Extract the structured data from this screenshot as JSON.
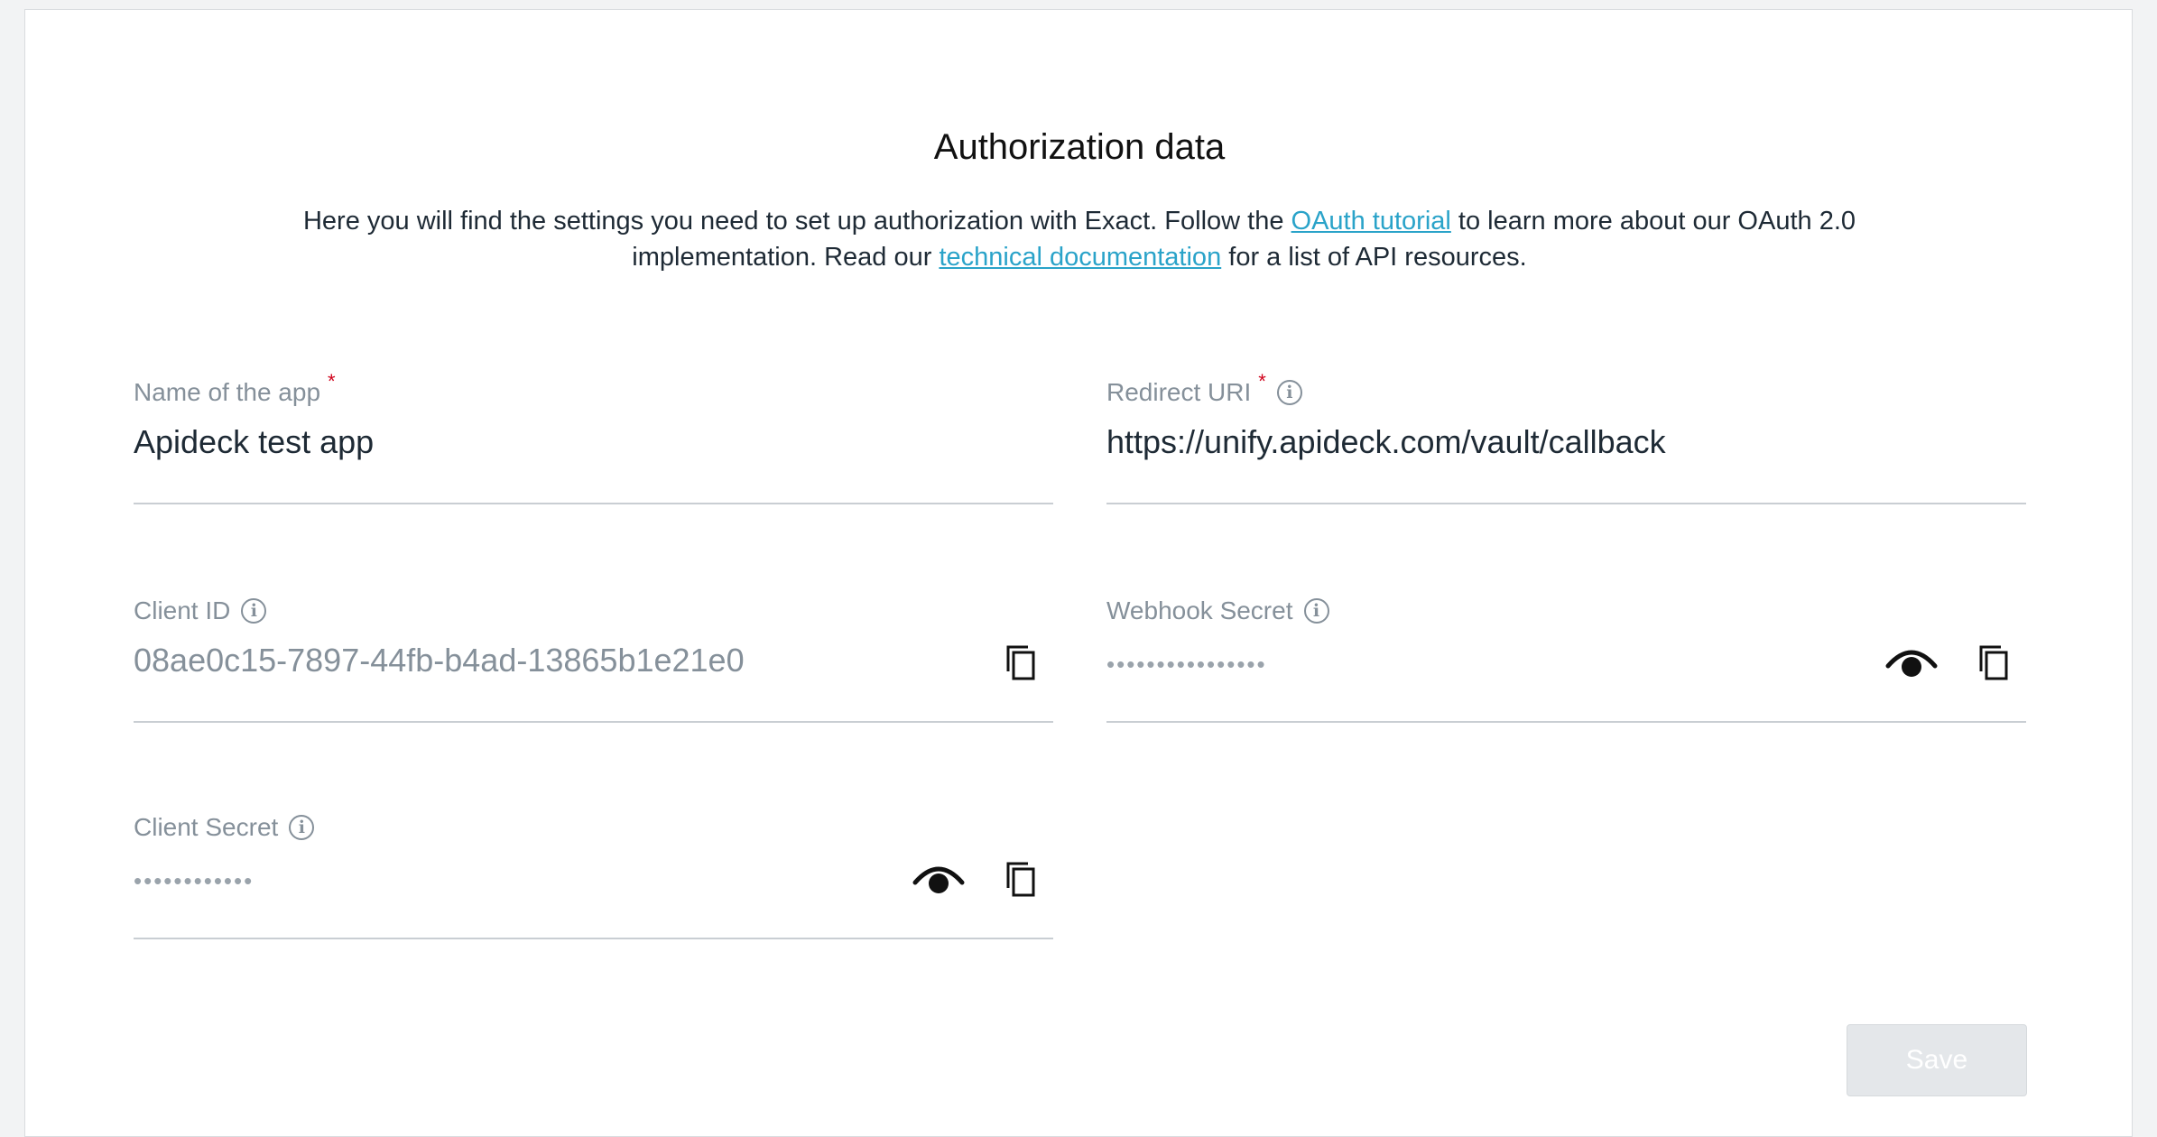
{
  "title": "Authorization data",
  "intro": {
    "before_link1": "Here you will find the settings you need to set up authorization with Exact. Follow the ",
    "link1": "OAuth tutorial",
    "between": " to learn more about our OAuth 2.0 implementation. Read our ",
    "link2": "technical documentation",
    "after": " for a list of API resources."
  },
  "fields": {
    "app_name": {
      "label": "Name of the app",
      "required_marker": "*",
      "value": "Apideck test app"
    },
    "redirect_uri": {
      "label": "Redirect URI",
      "required_marker": "*",
      "value": "https://unify.apideck.com/vault/callback"
    },
    "client_id": {
      "label": "Client ID",
      "value": "08ae0c15-7897-44fb-b4ad-13865b1e21e0"
    },
    "webhook_secret": {
      "label": "Webhook Secret",
      "value": "••••••••••••••••"
    },
    "client_secret": {
      "label": "Client Secret",
      "value": "••••••••••••"
    }
  },
  "info_glyph": "i",
  "icons": {
    "info": "info-icon",
    "reveal": "eye-icon",
    "copy": "copy-icon"
  },
  "save_label": "Save",
  "colors": {
    "link": "#2aa3c9",
    "required": "#d0021b",
    "label": "#85909a",
    "button_disabled": "#e4e7ea"
  }
}
